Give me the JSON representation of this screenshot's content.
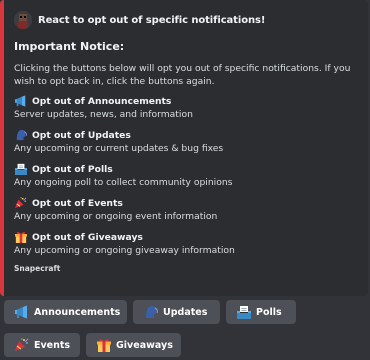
{
  "embed": {
    "accent_color": "#da373c",
    "author": {
      "icon": "robot-avatar-icon",
      "name": "React to opt out of specific notifications!"
    },
    "title": "Important Notice:",
    "description": "Clicking the buttons below will opt you out of specific notifications. If you wish to opt back in, click the buttons again.",
    "fields": [
      {
        "icon": "megaphone-icon",
        "name": "Opt out of Announcements",
        "value": "Server updates, news, and information"
      },
      {
        "icon": "speaking-head-icon",
        "name": "Opt out of Updates",
        "value": "Any upcoming or current updates & bug fixes"
      },
      {
        "icon": "ballot-box-icon",
        "name": "Opt out of Polls",
        "value": "Any ongoing poll to collect community opinions"
      },
      {
        "icon": "party-popper-icon",
        "name": "Opt out of Events",
        "value": "Any upcoming or ongoing event information"
      },
      {
        "icon": "gift-icon",
        "name": "Opt out of Giveaways",
        "value": "Any upcoming or ongoing giveaway information"
      }
    ],
    "footer": "Snapecraft"
  },
  "buttons": [
    {
      "icon": "megaphone-icon",
      "label": "Announcements"
    },
    {
      "icon": "speaking-head-icon",
      "label": "Updates"
    },
    {
      "icon": "ballot-box-icon",
      "label": "Polls"
    },
    {
      "icon": "party-popper-icon",
      "label": "Events"
    },
    {
      "icon": "gift-icon",
      "label": "Giveaways"
    }
  ]
}
